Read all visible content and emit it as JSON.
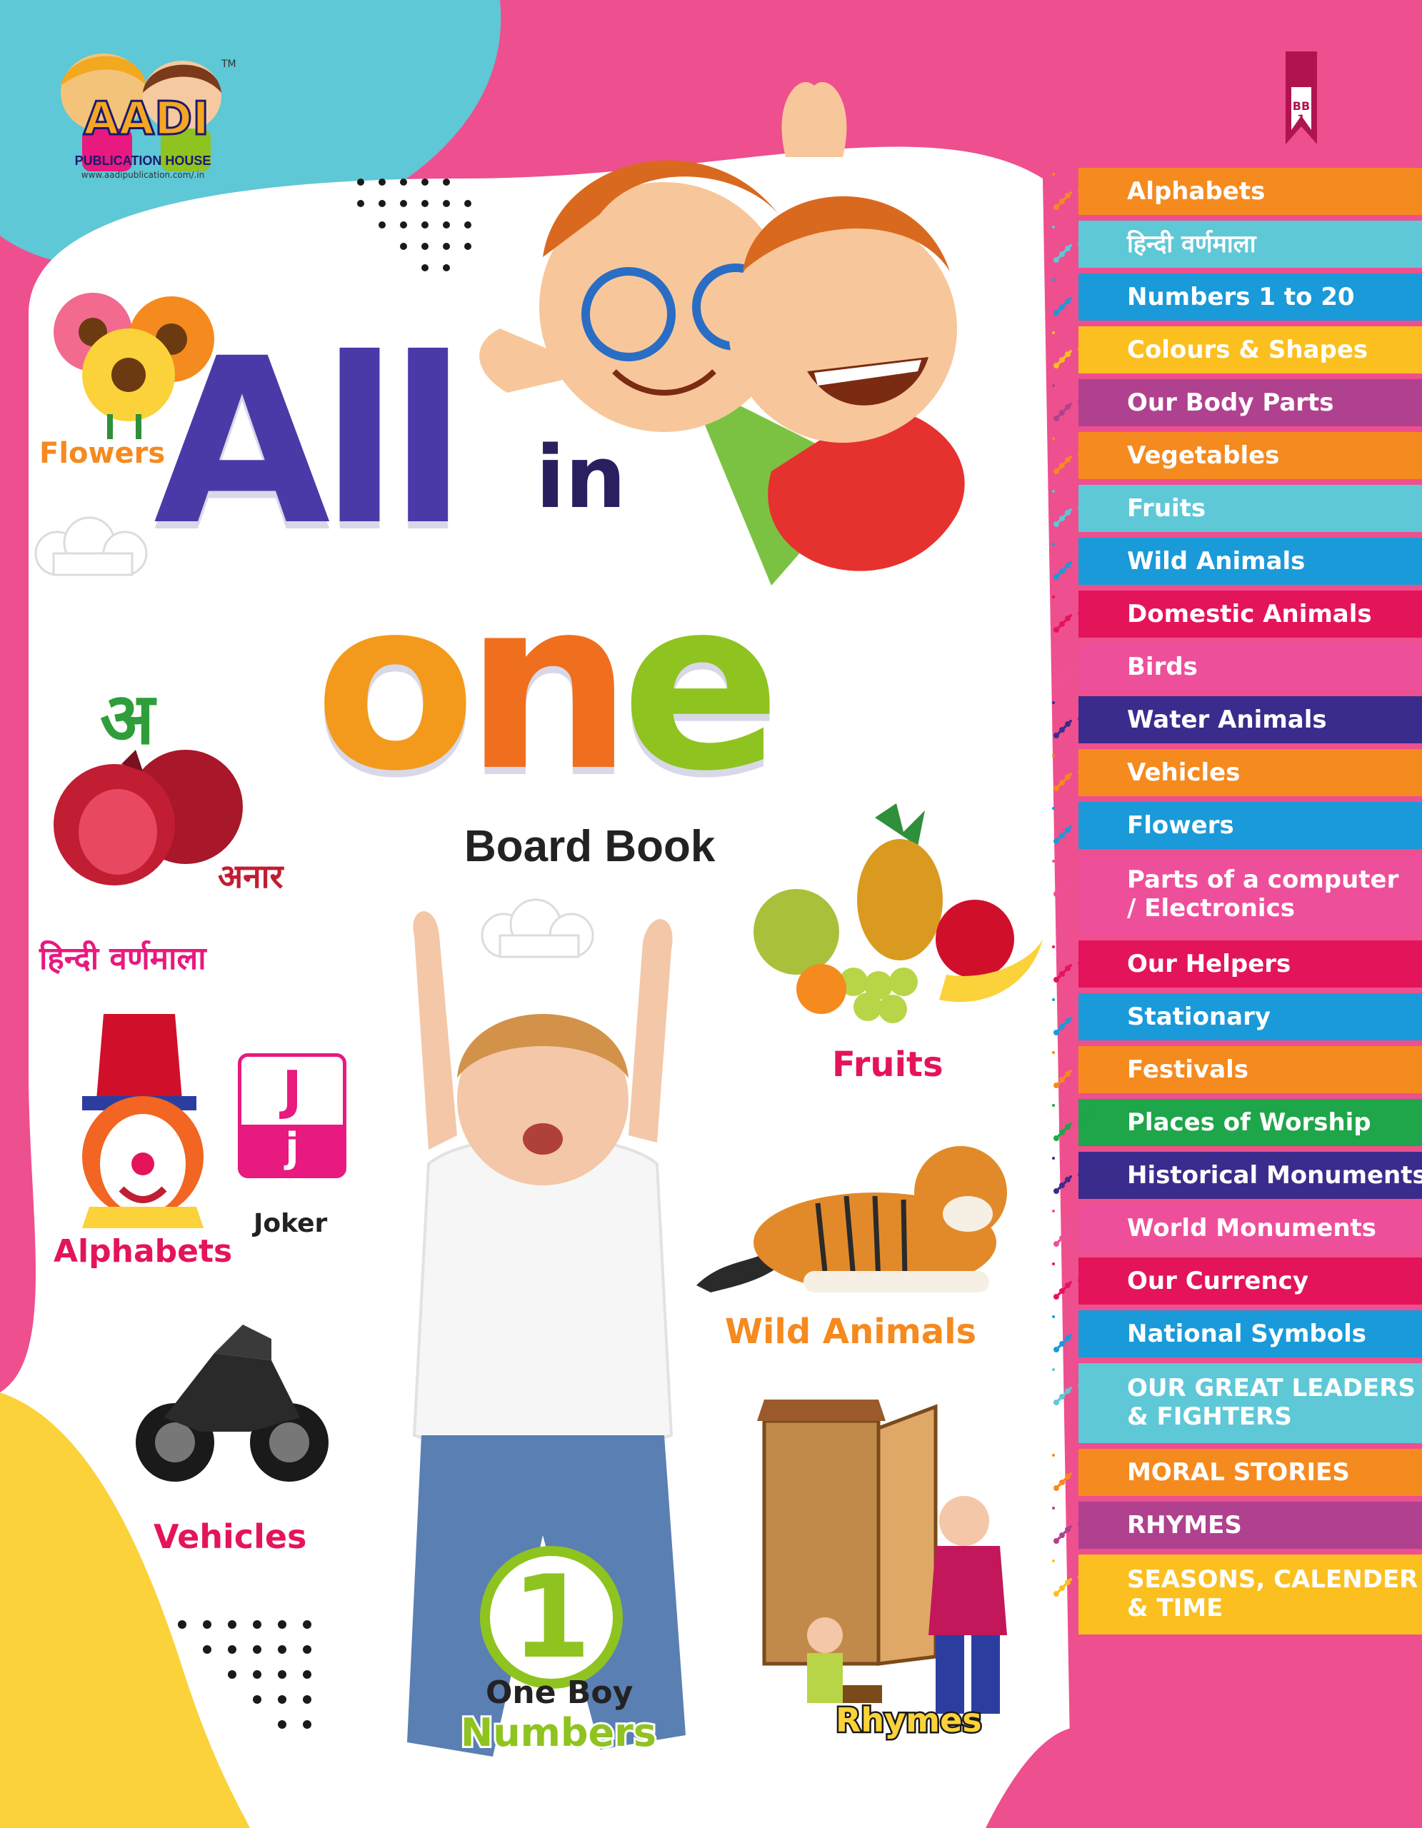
{
  "logo": {
    "brand": "AADI",
    "name": "PUBLICATION HOUSE",
    "url": "www.aadipublication.com/.in",
    "tm": "TM"
  },
  "series": {
    "code": "BB\n1"
  },
  "title": {
    "all": "All",
    "in": "in",
    "one_o": "o",
    "one_n": "n",
    "one_e": "e",
    "subtitle": "Board Book"
  },
  "labels": {
    "flowers": "Flowers",
    "hindi_letter": "अ",
    "hindi_word": "अनार",
    "hindi_varnamala": "हिन्दी वर्णमाला",
    "alphabets": "Alphabets",
    "joker_upper": "J",
    "joker_lower": "j",
    "joker": "Joker",
    "vehicles": "Vehicles",
    "fruits": "Fruits",
    "wild_animals": "Wild Animals",
    "rhymes": "Rhymes",
    "number": "1",
    "one_boy": "One Boy",
    "numbers": "Numbers"
  },
  "colors": {
    "pink": "#e8197f",
    "magenta_bg": "#ee4f8e",
    "cyan": "#5ec8d6",
    "yellow": "#fbd23a",
    "orange": "#f58a1f",
    "green": "#8fc31f",
    "purple": "#4a3aa8"
  },
  "toc": [
    {
      "label": "Alphabets",
      "color": "#f58a1f"
    },
    {
      "label": "हिन्दी वर्णमाला",
      "color": "#5ec8d6"
    },
    {
      "label": "Numbers 1 to 20",
      "color": "#1a9ad9"
    },
    {
      "label": "Colours & Shapes",
      "color": "#fbbf1f"
    },
    {
      "label": "Our Body Parts",
      "color": "#b0418f"
    },
    {
      "label": "Vegetables",
      "color": "#f58a1f"
    },
    {
      "label": "Fruits",
      "color": "#5ec8d6"
    },
    {
      "label": "Wild Animals",
      "color": "#1a9ad9"
    },
    {
      "label": "Domestic Animals",
      "color": "#e4145b"
    },
    {
      "label": "Birds",
      "color": "#ee4f9a"
    },
    {
      "label": "Water Animals",
      "color": "#3a2c8c"
    },
    {
      "label": "Vehicles",
      "color": "#f58a1f"
    },
    {
      "label": "Flowers",
      "color": "#1a9ad9"
    },
    {
      "label": "Parts of a computer\n/ Electronics",
      "color": "#ee4f9a"
    },
    {
      "label": "Our Helpers",
      "color": "#e4145b"
    },
    {
      "label": "Stationary",
      "color": "#1a9ad9"
    },
    {
      "label": "Festivals",
      "color": "#f58a1f"
    },
    {
      "label": "Places of Worship",
      "color": "#1fa54a"
    },
    {
      "label": "Historical Monuments",
      "color": "#3a2c8c"
    },
    {
      "label": "World Monuments",
      "color": "#ee4f9a"
    },
    {
      "label": "Our Currency",
      "color": "#e4145b"
    },
    {
      "label": "National Symbols",
      "color": "#1a9ad9"
    },
    {
      "label": "OUR GREAT LEADERS\n& FIGHTERS",
      "color": "#5ec8d6"
    },
    {
      "label": "MORAL STORIES",
      "color": "#f58a1f"
    },
    {
      "label": "RHYMES",
      "color": "#b0418f"
    },
    {
      "label": "SEASONS, CALENDER\n& TIME",
      "color": "#fbbf1f"
    }
  ]
}
